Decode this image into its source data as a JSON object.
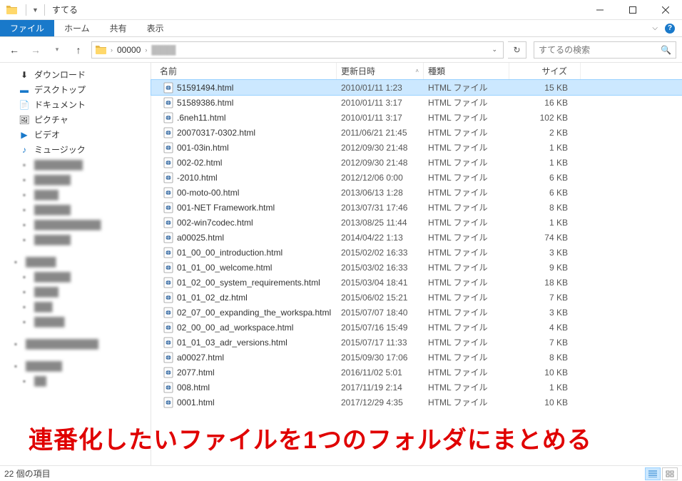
{
  "window": {
    "title": "すてる"
  },
  "ribbon": {
    "file": "ファイル",
    "home": "ホーム",
    "share": "共有",
    "view": "表示"
  },
  "breadcrumb": {
    "seg1": "00000"
  },
  "search": {
    "placeholder": "すてるの検索"
  },
  "tree": {
    "downloads": "ダウンロード",
    "desktop": "デスクトップ",
    "documents": "ドキュメント",
    "pictures": "ピクチャ",
    "videos": "ビデオ",
    "music": "ミュージック"
  },
  "columns": {
    "name": "名前",
    "date": "更新日時",
    "type": "種類",
    "size": "サイズ"
  },
  "filetype": "HTML ファイル",
  "files": [
    {
      "name": "51591494.html",
      "date": "2010/01/11 1:23",
      "size": "15 KB"
    },
    {
      "name": "51589386.html",
      "date": "2010/01/11 3:17",
      "size": "16 KB"
    },
    {
      "name": ".6neh11.html",
      "date": "2010/01/11 3:17",
      "size": "102 KB"
    },
    {
      "name": "20070317-0302.html",
      "date": "2011/06/21 21:45",
      "size": "2 KB"
    },
    {
      "name": "001-03in.html",
      "date": "2012/09/30 21:48",
      "size": "1 KB"
    },
    {
      "name": "002-02.html",
      "date": "2012/09/30 21:48",
      "size": "1 KB"
    },
    {
      "name": "-2010.html",
      "date": "2012/12/06 0:00",
      "size": "6 KB"
    },
    {
      "name": "00-moto-00.html",
      "date": "2013/06/13 1:28",
      "size": "6 KB"
    },
    {
      "name": "001-NET Framework.html",
      "date": "2013/07/31 17:46",
      "size": "8 KB"
    },
    {
      "name": "002-win7codec.html",
      "date": "2013/08/25 11:44",
      "size": "1 KB"
    },
    {
      "name": "a00025.html",
      "date": "2014/04/22 1:13",
      "size": "74 KB"
    },
    {
      "name": "01_00_00_introduction.html",
      "date": "2015/02/02 16:33",
      "size": "3 KB"
    },
    {
      "name": "01_01_00_welcome.html",
      "date": "2015/03/02 16:33",
      "size": "9 KB"
    },
    {
      "name": "01_02_00_system_requirements.html",
      "date": "2015/03/04 18:41",
      "size": "18 KB"
    },
    {
      "name": "01_01_02_dz.html",
      "date": "2015/06/02 15:21",
      "size": "7 KB"
    },
    {
      "name": "02_07_00_expanding_the_workspa.html",
      "date": "2015/07/07 18:40",
      "size": "3 KB"
    },
    {
      "name": "02_00_00_ad_workspace.html",
      "date": "2015/07/16 15:49",
      "size": "4 KB"
    },
    {
      "name": "01_01_03_adr_versions.html",
      "date": "2015/07/17 11:33",
      "size": "7 KB"
    },
    {
      "name": "a00027.html",
      "date": "2015/09/30 17:06",
      "size": "8 KB"
    },
    {
      "name": "2077.html",
      "date": "2016/11/02 5:01",
      "size": "10 KB"
    },
    {
      "name": "008.html",
      "date": "2017/11/19 2:14",
      "size": "1 KB"
    },
    {
      "name": "0001.html",
      "date": "2017/12/29 4:35",
      "size": "10 KB"
    }
  ],
  "status": {
    "items": "22 個の項目"
  },
  "annotation": "連番化したいファイルを1つのフォルダにまとめる"
}
